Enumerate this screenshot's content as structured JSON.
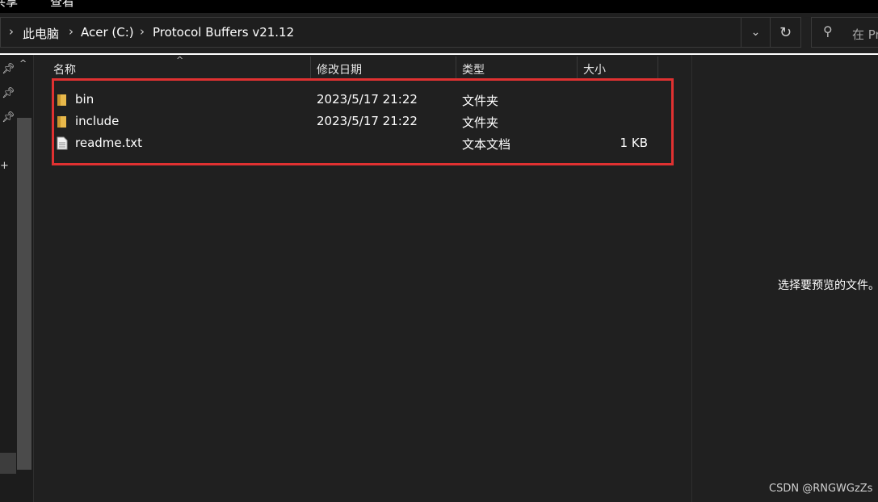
{
  "ribbon": {
    "tabs": [
      "共享",
      "查看"
    ]
  },
  "address": {
    "segments": [
      "此电脑",
      "Acer (C:)",
      "Protocol Buffers v21.12"
    ]
  },
  "search": {
    "placeholder": "在 Pr"
  },
  "columns": {
    "name": "名称",
    "modified": "修改日期",
    "type": "类型",
    "size": "大小"
  },
  "files": [
    {
      "name": "bin",
      "modified": "2023/5/17 21:22",
      "type": "文件夹",
      "size": "",
      "icon": "folder-icon"
    },
    {
      "name": "include",
      "modified": "2023/5/17 21:22",
      "type": "文件夹",
      "size": "",
      "icon": "folder-icon"
    },
    {
      "name": "readme.txt",
      "modified": "",
      "type": "文本文档",
      "size": "1 KB",
      "icon": "text-file-icon"
    }
  ],
  "preview": {
    "message": "选择要预览的文件。"
  },
  "watermark": "CSDN @RNGWGzZs",
  "colors": {
    "highlight": "#e03131",
    "folder": "#e8b84a",
    "background": "#202020"
  }
}
